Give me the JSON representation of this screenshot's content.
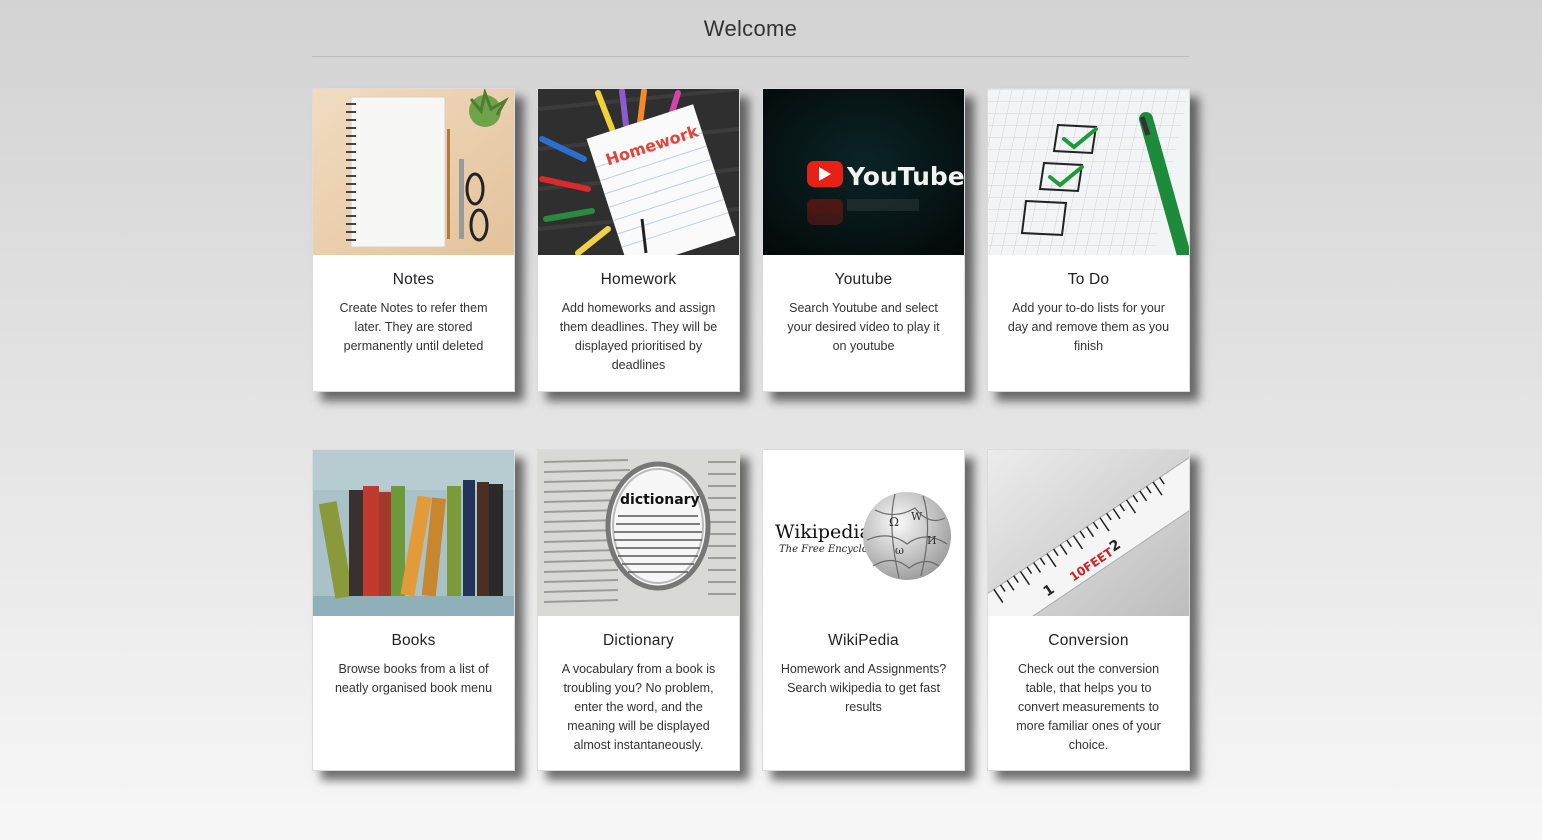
{
  "page": {
    "title": "Welcome"
  },
  "cards": [
    {
      "title": "Notes",
      "description": "Create Notes to refer them later. They are stored permanently until deleted",
      "image": "notebook-image"
    },
    {
      "title": "Homework",
      "description": "Add homeworks and assign them deadlines. They will be displayed prioritised by deadlines",
      "image": "homework-image",
      "image_text": "Homework"
    },
    {
      "title": "Youtube",
      "description": "Search Youtube and select your desired video to play it on youtube",
      "image": "youtube-logo-image",
      "image_text": "YouTube"
    },
    {
      "title": "To Do",
      "description": "Add your to-do lists for your day and remove them as you finish",
      "image": "checklist-image"
    },
    {
      "title": "Books",
      "description": "Browse books from a list of neatly organised book menu",
      "image": "bookshelf-image"
    },
    {
      "title": "Dictionary",
      "description": "A vocabulary from a book is troubling you? No problem, enter the word, and the meaning will be displayed almost instantaneously.",
      "image": "dictionary-magnifier-image",
      "image_text": "dictionary"
    },
    {
      "title": "WikiPedia",
      "description": "Homework and Assignments? Search wikipedia to get fast results",
      "image": "wikipedia-logo-image",
      "image_text": "Wikipedia",
      "image_subtext": "The Free Encyclopedia"
    },
    {
      "title": "Conversion",
      "description": "Check out the conversion table, that helps you to convert measurements to more familiar ones of your choice.",
      "image": "tape-measure-image",
      "image_text": "10FEET"
    }
  ]
}
